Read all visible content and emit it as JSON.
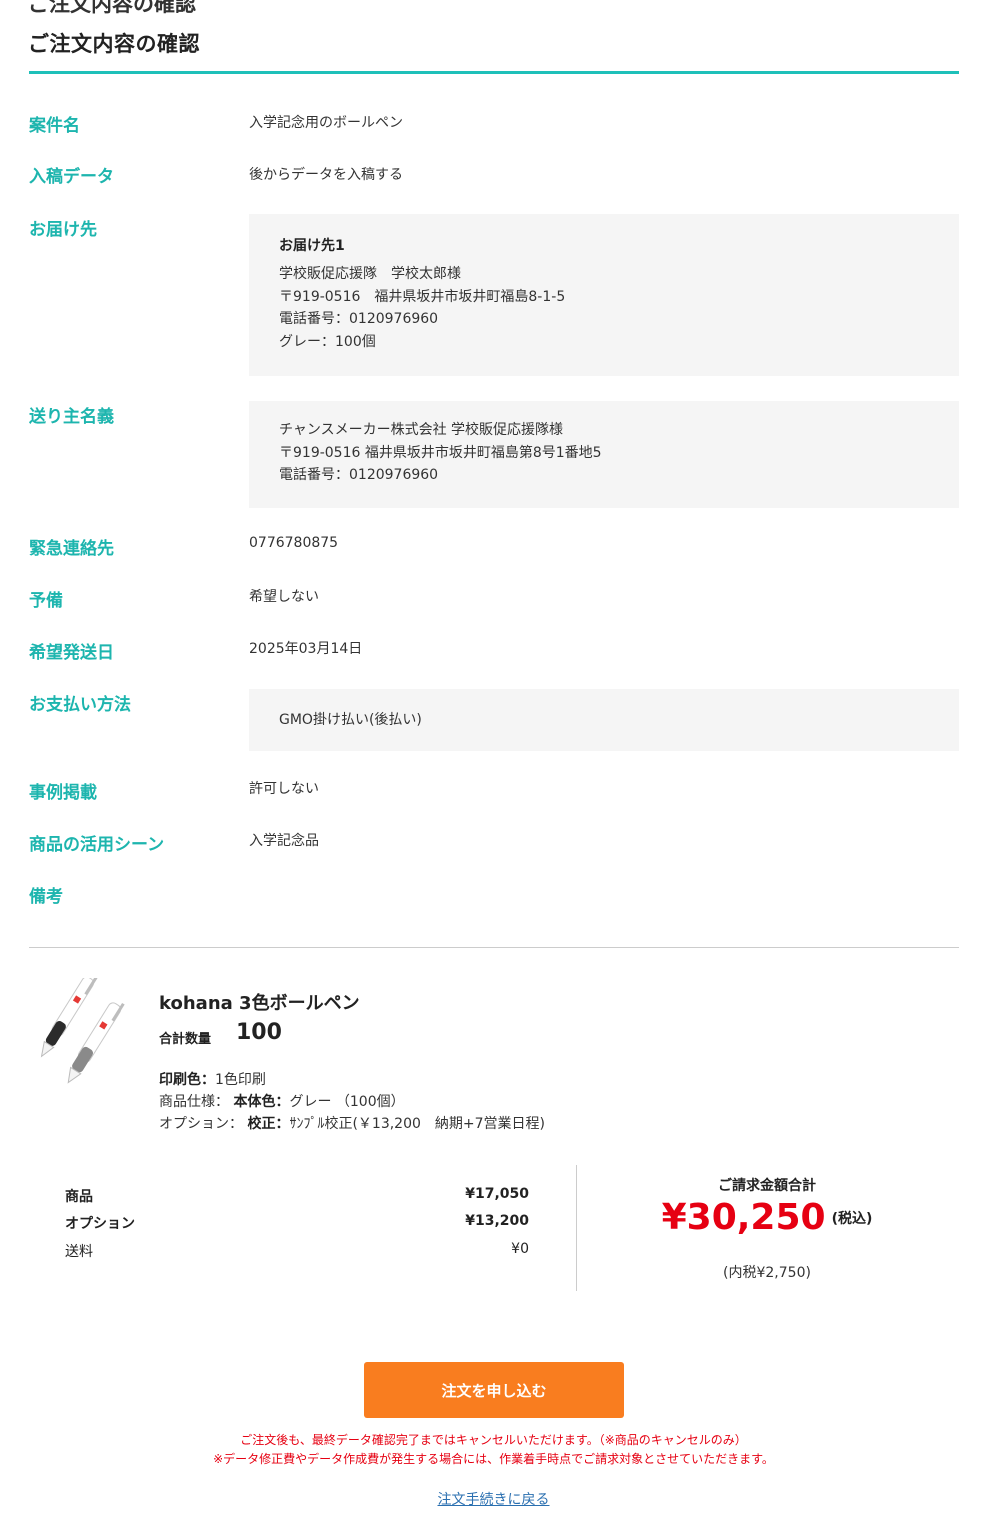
{
  "page": {
    "ghost_title": "ご注文内容の確認",
    "title": "ご注文内容の確認"
  },
  "details": {
    "project_name": {
      "label": "案件名",
      "value": "入学記念用のボールペン"
    },
    "submission": {
      "label": "入稿データ",
      "value": "後からデータを入稿する"
    },
    "delivery": {
      "label": "お届け先",
      "heading": "お届け先1",
      "lines": [
        "学校販促応援隊　学校太郎様",
        "〒919-0516　福井県坂井市坂井町福島8-1-5",
        "電話番号：0120976960",
        "グレー：100個"
      ]
    },
    "sender": {
      "label": "送り主名義",
      "lines": [
        "チャンスメーカー株式会社 学校販促応援隊様",
        "〒919-0516 福井県坂井市坂井町福島第8号1番地5",
        "電話番号：0120976960"
      ]
    },
    "emergency_contact": {
      "label": "緊急連絡先",
      "value": "0776780875"
    },
    "spare": {
      "label": "予備",
      "value": "希望しない"
    },
    "ship_date": {
      "label": "希望発送日",
      "value": "2025年03月14日"
    },
    "payment": {
      "label": "お支払い方法",
      "value": "GMO掛け払い(後払い)"
    },
    "case_study": {
      "label": "事例掲載",
      "value": "許可しない"
    },
    "usage_scene": {
      "label": "商品の活用シーン",
      "value": "入学記念品"
    },
    "remarks": {
      "label": "備考",
      "value": ""
    }
  },
  "product": {
    "name": "kohana 3色ボールペン",
    "qty_label": "合計数量",
    "qty": "100",
    "print_color_label": "印刷色：",
    "print_color": "1色印刷",
    "spec_label": "商品仕様：",
    "body_color_label": "本体色：",
    "body_color": "グレー （100個）",
    "option_label": "オプション：",
    "proof_label": "校正：",
    "proof_value": "ｻﾝﾌﾟﾙ校正(￥13,200　納期+7営業日程)"
  },
  "prices": {
    "goods_label": "商品",
    "goods": "¥17,050",
    "option_label": "オプション",
    "option": "¥13,200",
    "shipping_label": "送料",
    "shipping": "¥0",
    "total_label": "ご請求金額合計",
    "total": "¥30,250",
    "tax_included": "(税込)",
    "tax_note": "(内税¥2,750)"
  },
  "actions": {
    "submit": "注文を申し込む",
    "notice_1": "ご注文後も、最終データ確認完了まではキャンセルいただけます。（※商品のキャンセルのみ）",
    "notice_2": "※データ修正費やデータ作成費が発生する場合には、作業着手時点でご請求対象とさせていただきます。",
    "back": "注文手続きに戻る"
  },
  "colors": {
    "accent_teal": "#1db5ae",
    "price_red": "#e60012",
    "button_orange": "#f97d1f",
    "link_blue": "#2a6fb0"
  }
}
